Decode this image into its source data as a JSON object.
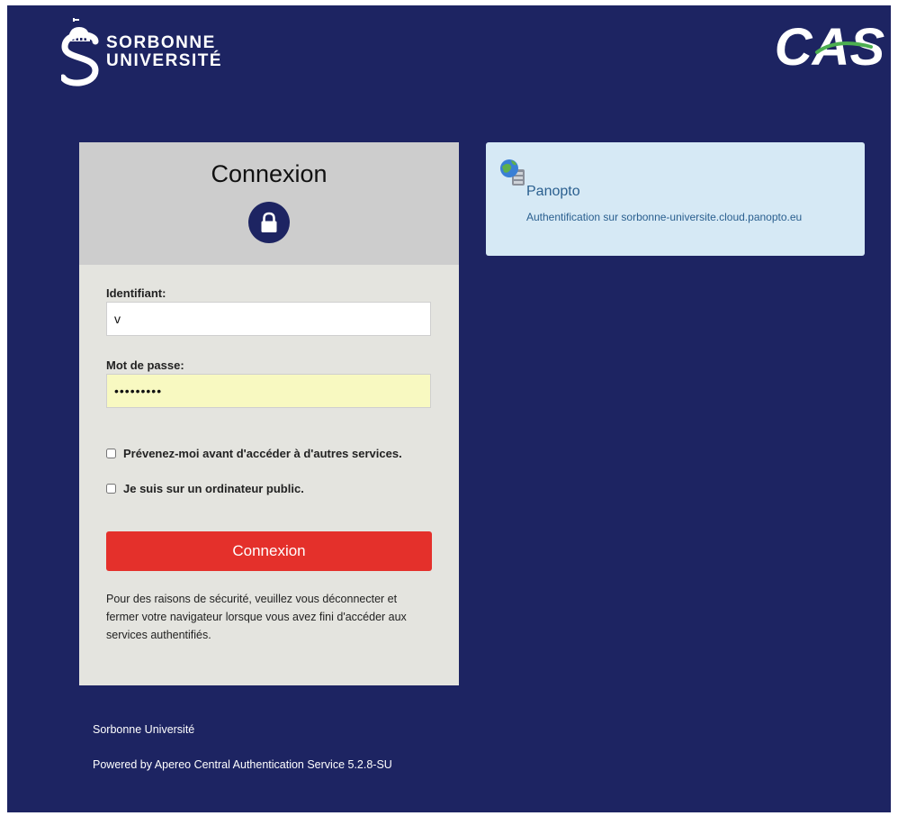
{
  "header": {
    "brand_line1": "SORBONNE",
    "brand_line2": "UNIVERSITÉ",
    "cas_logo_text": "CAS"
  },
  "login": {
    "title": "Connexion",
    "username_label": "Identifiant:",
    "username_value": "v",
    "password_label": "Mot de passe:",
    "password_value": "•••••••••",
    "warn_checkbox_label": "Prévenez-moi avant d'accéder à d'autres services.",
    "public_checkbox_label": "Je suis sur un ordinateur public.",
    "submit_label": "Connexion",
    "security_notice": "Pour des raisons de sécurité, veuillez vous déconnecter et fermer votre navigateur lorsque vous avez fini d'accéder aux services authentifiés."
  },
  "service": {
    "name": "Panopto",
    "description": "Authentification sur sorbonne-universite.cloud.panopto.eu",
    "icon": "globe-server-icon"
  },
  "footer": {
    "org": "Sorbonne Université",
    "powered_by": "Powered by Apereo Central Authentication Service 5.2.8-SU"
  },
  "colors": {
    "background": "#1d2462",
    "panel": "#e4e4df",
    "panel_header": "#cdcdcd",
    "submit": "#e4302b",
    "service_card": "#d6e9f5",
    "password_fill": "#f8f9c1"
  }
}
